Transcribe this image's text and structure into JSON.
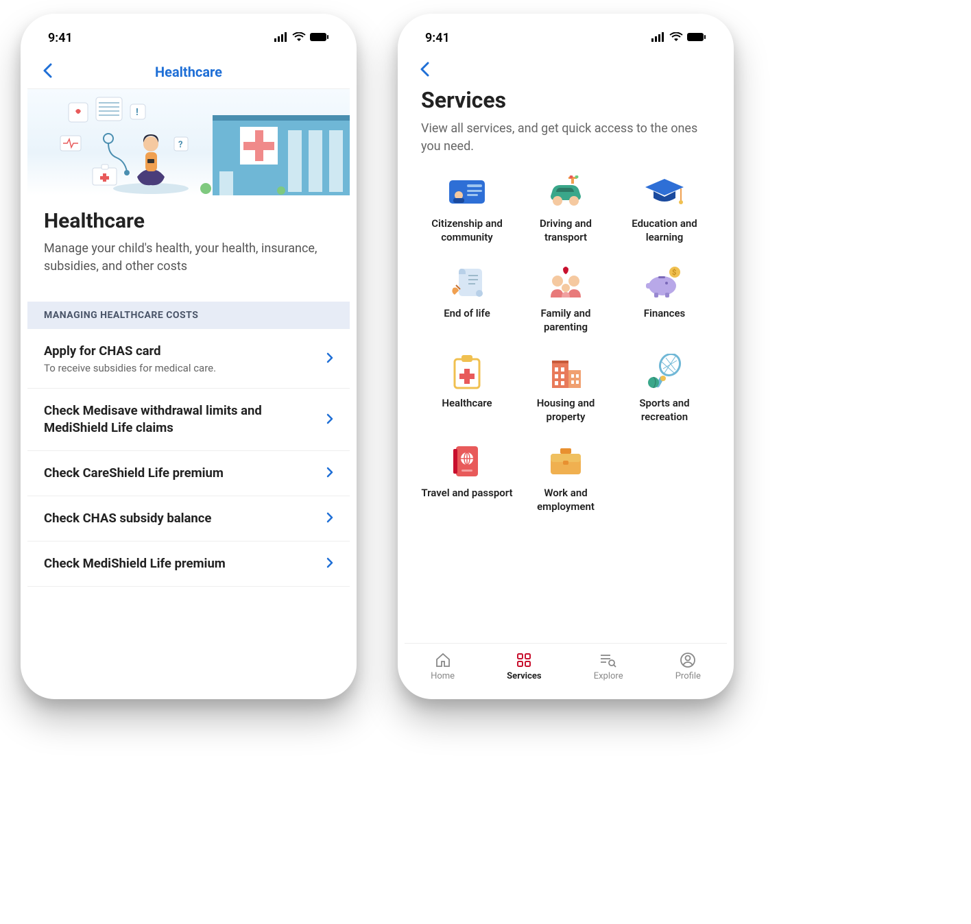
{
  "status": {
    "time": "9:41"
  },
  "phone1": {
    "nav_title": "Healthcare",
    "page_title": "Healthcare",
    "page_subtitle": "Manage your child's health, your health, insurance, subsidies, and other costs",
    "section_header": "MANAGING HEALTHCARE COSTS",
    "items": [
      {
        "title": "Apply for CHAS card",
        "sub": "To receive subsidies for medical care."
      },
      {
        "title": "Check Medisave withdrawal limits and MediShield Life claims",
        "sub": ""
      },
      {
        "title": "Check CareShield Life premium",
        "sub": ""
      },
      {
        "title": "Check CHAS subsidy balance",
        "sub": ""
      },
      {
        "title": "Check MediShield Life premium",
        "sub": ""
      }
    ]
  },
  "phone2": {
    "page_title": "Services",
    "page_subtitle": "View all services, and get quick access to the ones you need.",
    "grid": [
      {
        "label": "Citizenship and community"
      },
      {
        "label": "Driving and transport"
      },
      {
        "label": "Education and learning"
      },
      {
        "label": "End of life"
      },
      {
        "label": "Family and parenting"
      },
      {
        "label": "Finances"
      },
      {
        "label": "Healthcare"
      },
      {
        "label": "Housing and property"
      },
      {
        "label": "Sports and recreation"
      },
      {
        "label": "Travel and passport"
      },
      {
        "label": "Work and employment"
      }
    ],
    "tabs": [
      {
        "label": "Home"
      },
      {
        "label": "Services"
      },
      {
        "label": "Explore"
      },
      {
        "label": "Profile"
      }
    ]
  }
}
